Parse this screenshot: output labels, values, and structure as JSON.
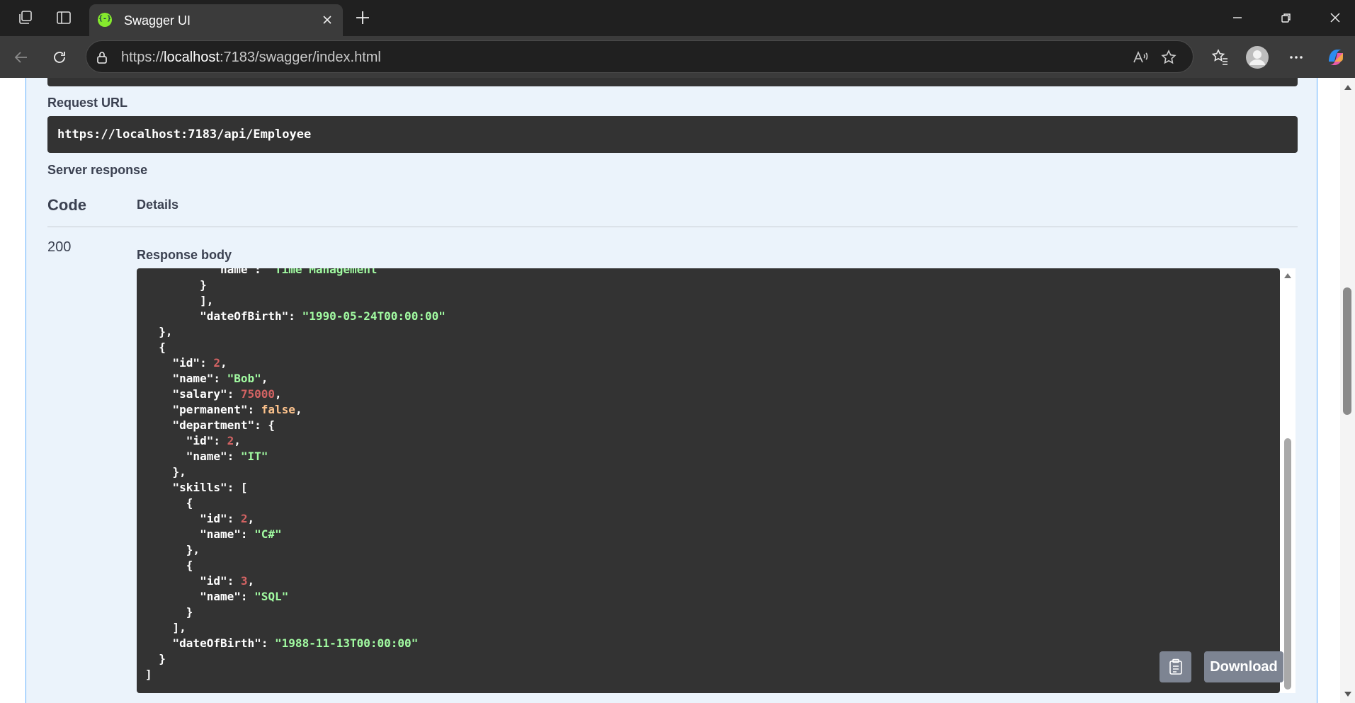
{
  "browser": {
    "tab_title": "Swagger UI",
    "url_prefix": "https://",
    "url_host": "localhost",
    "url_rest": ":7183/swagger/index.html"
  },
  "page": {
    "request_url_label": "Request URL",
    "request_url": "https://localhost:7183/api/Employee",
    "server_response_label": "Server response",
    "code_header": "Code",
    "details_header": "Details",
    "status_code": "200",
    "response_body_label": "Response body",
    "download_label": "Download"
  },
  "response_lines": [
    [
      [
        "    ",
        "p"
      ],
      [
        "\"name\"",
        "k"
      ],
      [
        ": ",
        "p"
      ],
      [
        "\"Time Management\"",
        "s"
      ]
    ],
    [
      [
        "  }",
        "p"
      ]
    ],
    [
      [
        "  ],",
        "p"
      ]
    ],
    [
      [
        "  ",
        "p"
      ],
      [
        "\"dateOfBirth\"",
        "k"
      ],
      [
        ": ",
        "p"
      ],
      [
        "\"1990-05-24T00:00:00\"",
        "s"
      ]
    ],
    [
      [
        "},",
        "p"
      ]
    ],
    [
      [
        "{",
        "p"
      ]
    ],
    [
      [
        "  ",
        "p"
      ],
      [
        "\"id\"",
        "k"
      ],
      [
        ": ",
        "p"
      ],
      [
        "2",
        "n"
      ],
      [
        ",",
        "p"
      ]
    ],
    [
      [
        "  ",
        "p"
      ],
      [
        "\"name\"",
        "k"
      ],
      [
        ": ",
        "p"
      ],
      [
        "\"Bob\"",
        "s"
      ],
      [
        ",",
        "p"
      ]
    ],
    [
      [
        "  ",
        "p"
      ],
      [
        "\"salary\"",
        "k"
      ],
      [
        ": ",
        "p"
      ],
      [
        "75000",
        "n"
      ],
      [
        ",",
        "p"
      ]
    ],
    [
      [
        "  ",
        "p"
      ],
      [
        "\"permanent\"",
        "k"
      ],
      [
        ": ",
        "p"
      ],
      [
        "false",
        "b"
      ],
      [
        ",",
        "p"
      ]
    ],
    [
      [
        "  ",
        "p"
      ],
      [
        "\"department\"",
        "k"
      ],
      [
        ": {",
        "p"
      ]
    ],
    [
      [
        "    ",
        "p"
      ],
      [
        "\"id\"",
        "k"
      ],
      [
        ": ",
        "p"
      ],
      [
        "2",
        "n"
      ],
      [
        ",",
        "p"
      ]
    ],
    [
      [
        "    ",
        "p"
      ],
      [
        "\"name\"",
        "k"
      ],
      [
        ": ",
        "p"
      ],
      [
        "\"IT\"",
        "s"
      ]
    ],
    [
      [
        "  },",
        "p"
      ]
    ],
    [
      [
        "  ",
        "p"
      ],
      [
        "\"skills\"",
        "k"
      ],
      [
        ": [",
        "p"
      ]
    ],
    [
      [
        "    {",
        "p"
      ]
    ],
    [
      [
        "      ",
        "p"
      ],
      [
        "\"id\"",
        "k"
      ],
      [
        ": ",
        "p"
      ],
      [
        "2",
        "n"
      ],
      [
        ",",
        "p"
      ]
    ],
    [
      [
        "      ",
        "p"
      ],
      [
        "\"name\"",
        "k"
      ],
      [
        ": ",
        "p"
      ],
      [
        "\"C#\"",
        "s"
      ]
    ],
    [
      [
        "    },",
        "p"
      ]
    ],
    [
      [
        "    {",
        "p"
      ]
    ],
    [
      [
        "      ",
        "p"
      ],
      [
        "\"id\"",
        "k"
      ],
      [
        ": ",
        "p"
      ],
      [
        "3",
        "n"
      ],
      [
        ",",
        "p"
      ]
    ],
    [
      [
        "      ",
        "p"
      ],
      [
        "\"name\"",
        "k"
      ],
      [
        ": ",
        "p"
      ],
      [
        "\"SQL\"",
        "s"
      ]
    ],
    [
      [
        "    }",
        "p"
      ]
    ],
    [
      [
        "  ],",
        "p"
      ]
    ],
    [
      [
        "  ",
        "p"
      ],
      [
        "\"dateOfBirth\"",
        "k"
      ],
      [
        ": ",
        "p"
      ],
      [
        "\"1988-11-13T00:00:00\"",
        "s"
      ]
    ],
    [
      [
        "}",
        "p"
      ]
    ]
  ]
}
